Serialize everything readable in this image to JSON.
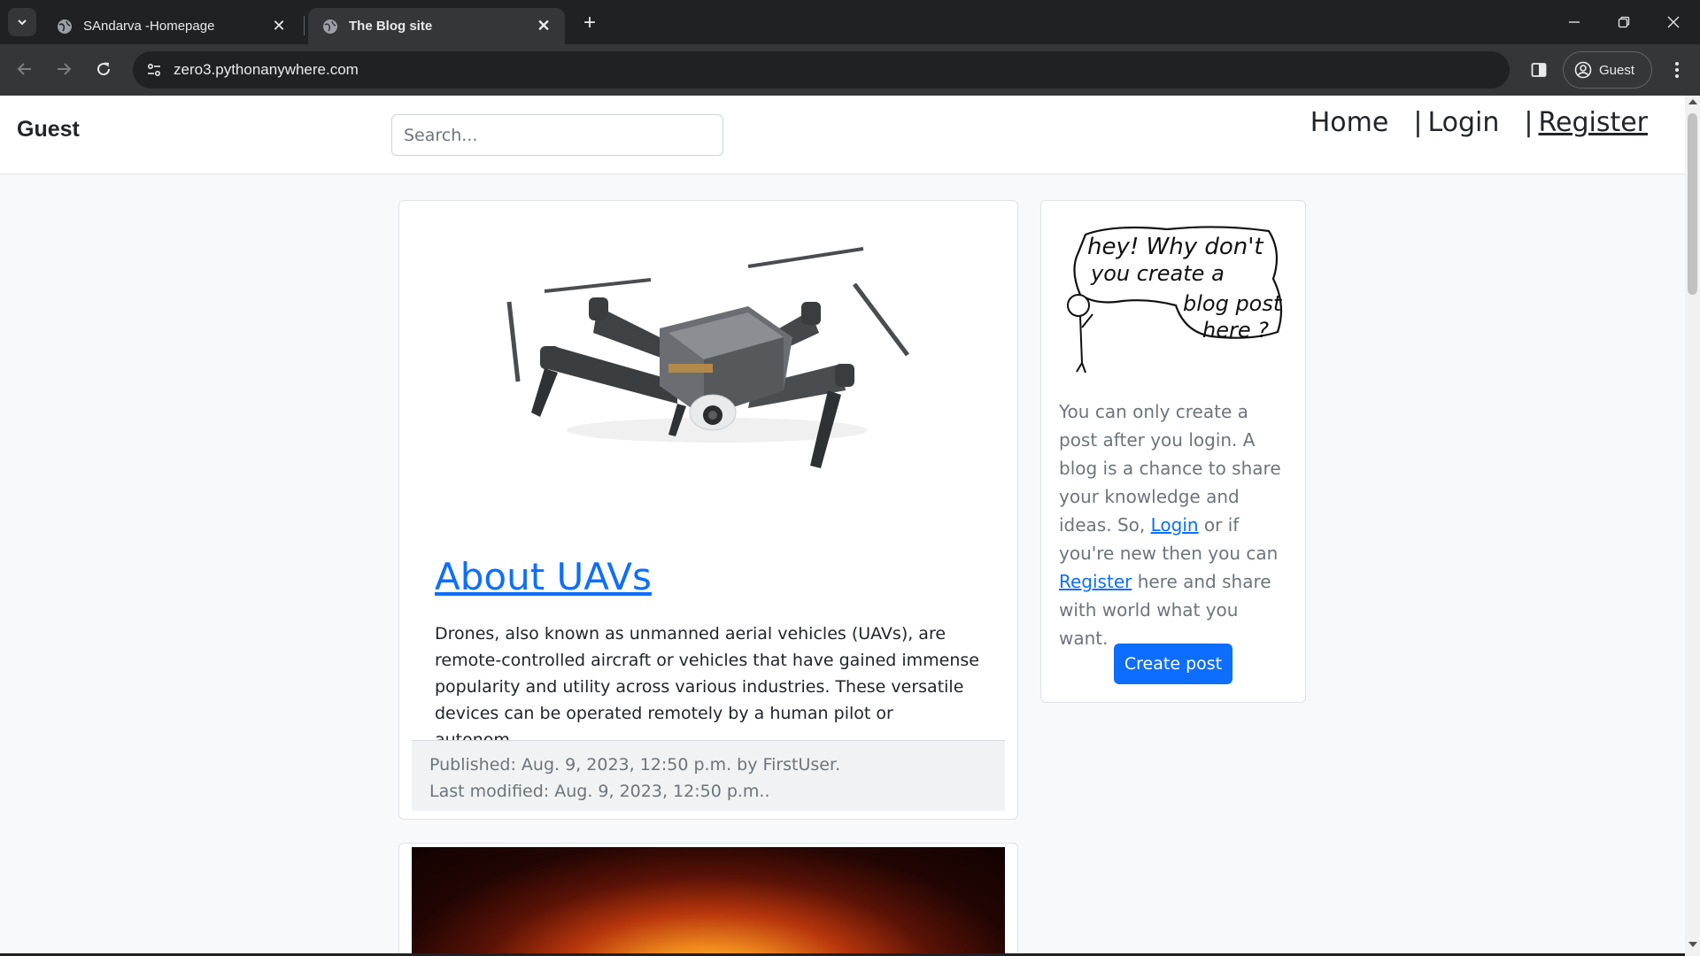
{
  "browser": {
    "tabs": [
      {
        "title": "SAndarva -Homepage",
        "active": false
      },
      {
        "title": "The Blog site",
        "active": true
      }
    ],
    "url": "zero3.pythonanywhere.com",
    "profile_label": "Guest"
  },
  "site": {
    "brand": "Guest",
    "search_placeholder": "Search...",
    "nav": {
      "home": "Home",
      "sep1": "|",
      "login": "Login",
      "sep2": "|",
      "register": "Register"
    }
  },
  "post": {
    "title": "About UAVs",
    "excerpt": "Drones, also known as unmanned aerial vehicles (UAVs), are remote-controlled aircraft or vehicles that have gained immense popularity and utility across various industries. These versatile devices can be operated remotely by a human pilot or autonom...",
    "published": "Published: Aug. 9, 2023, 12:50 p.m. by FirstUser.",
    "modified": "Last modified: Aug. 9, 2023, 12:50 p.m.."
  },
  "sidebar": {
    "doodle_text": [
      "hey! Why don't",
      "you create a",
      "blog post",
      "here ?"
    ],
    "text_before_login": "You can only create a post after you login. A blog is a chance to share your knowledge and ideas. So, ",
    "login_link": "Login",
    "text_middle": " or if you're new then you can ",
    "register_link": "Register",
    "text_after": " here and share with world what you want.",
    "create_button": "Create post"
  }
}
